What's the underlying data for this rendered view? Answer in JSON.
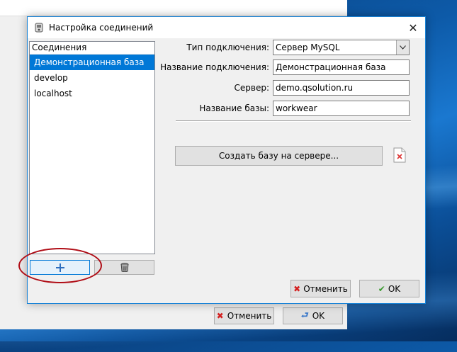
{
  "dialog": {
    "title": "Настройка соединений",
    "close_glyph": "✕"
  },
  "list": {
    "header": "Соединения",
    "items": [
      "Демонстрационная база",
      "develop",
      "localhost"
    ],
    "selected_index": 0
  },
  "form": {
    "type_label": "Тип подключения:",
    "type_value": "Сервер MySQL",
    "name_label": "Название подключения:",
    "name_value": "Демонстрационная база",
    "server_label": "Сервер:",
    "server_value": "demo.qsolution.ru",
    "db_label": "Название базы:",
    "db_value": "workwear",
    "create_db_button": "Создать базу на сервере..."
  },
  "buttons": {
    "cancel": "Отменить",
    "ok": "OK"
  },
  "background_window": {
    "cancel": "Отменить",
    "ok": "OK"
  },
  "colors": {
    "selection": "#0078d7",
    "dialog_border": "#1883d7",
    "highlight_ellipse": "#b00d16"
  }
}
